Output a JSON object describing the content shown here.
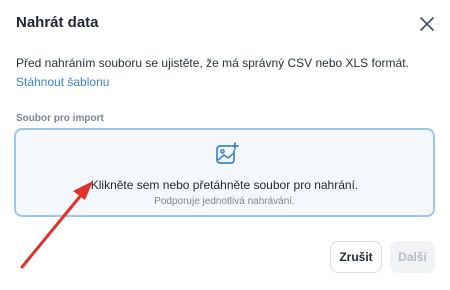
{
  "dialog": {
    "title": "Nahrát data",
    "close_icon": "close-icon",
    "description_text": "Před nahráním souboru se ujistěte, že má správný CSV nebo XLS formát. ",
    "description_link": "Stáhnout šablonu"
  },
  "import": {
    "field_label": "Soubor pro import",
    "upload_icon": "image-upload-icon",
    "dropzone_main": "Klikněte sem nebo přetáhněte soubor pro nahrání.",
    "dropzone_sub": "Podporuje jednotlivá nahrávání."
  },
  "footer": {
    "cancel_label": "Zrušit",
    "next_label": "Další"
  },
  "colors": {
    "accent": "#3a84c9",
    "dropzone_border": "#9cc7ea",
    "annotation_arrow": "#e0322a"
  }
}
